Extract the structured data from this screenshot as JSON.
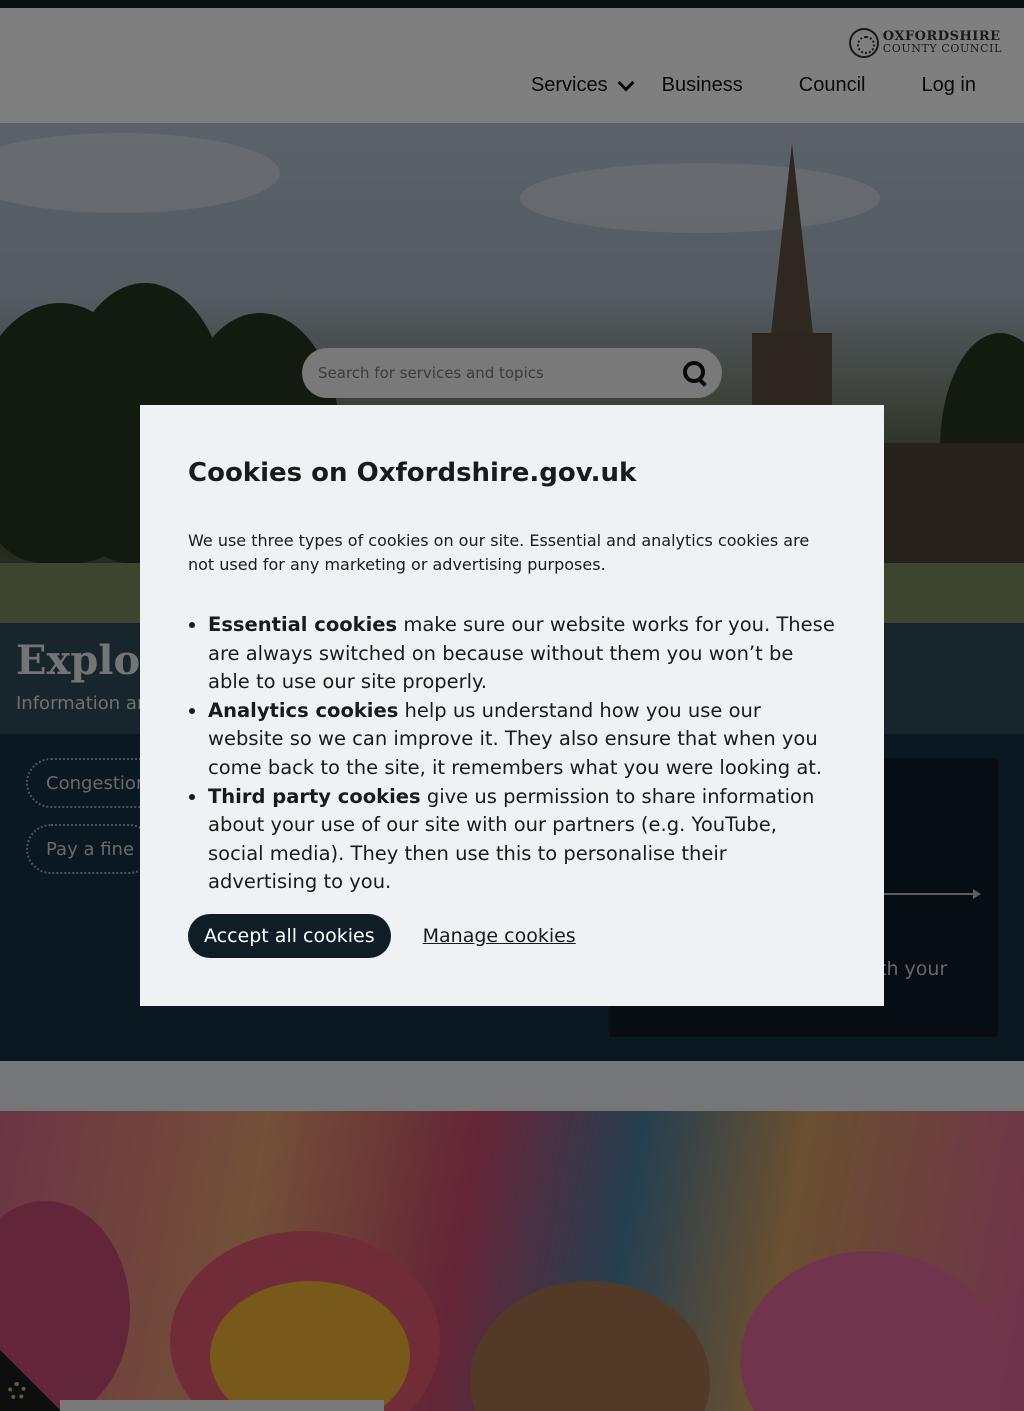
{
  "header": {
    "logo_line1": "OXFORDSHIRE",
    "logo_line2": "COUNTY COUNCIL",
    "nav": {
      "services": "Services",
      "business": "Business",
      "council": "Council",
      "login": "Log in"
    }
  },
  "search": {
    "placeholder": "Search for services and topics"
  },
  "explore": {
    "title": "Explore",
    "subtitle": "Information an"
  },
  "quick_links": {
    "congestion": "Congestion",
    "pay_fine": "Pay a fine"
  },
  "card": {
    "text_fragment": "th your"
  },
  "cookie_dialog": {
    "title": "Cookies on Oxfordshire.gov.uk",
    "intro": "We use three types of cookies on our site. Essential and analytics cookies are not used for any marketing or advertising purposes.",
    "items": [
      {
        "name": "Essential cookies",
        "text": " make sure our website works for you. These are always switched on because without them you won’t be able to use our site properly."
      },
      {
        "name": "Analytics cookies",
        "text": " help us understand how you use our website so we can improve it. They also ensure that when you come back to the site, it remembers what you were looking at."
      },
      {
        "name": "Third party cookies",
        "text": " give us permission to share information about your use of our site with our partners (e.g. YouTube, social media). They then use this to personalise their advertising to you."
      }
    ],
    "accept_label": "Accept all cookies",
    "manage_label": "Manage cookies"
  },
  "colors": {
    "dialog_bg": "#eff2f5",
    "accept_button": "#0f1d26",
    "top_bar": "#0f2229",
    "explore_band": "#2f4a58",
    "links_band": "#143043"
  },
  "icons": {
    "search": "search-icon",
    "services_dropdown": "chevron-down-icon",
    "cookie_settings": "gear-icon",
    "logo": "council-crest-icon"
  }
}
